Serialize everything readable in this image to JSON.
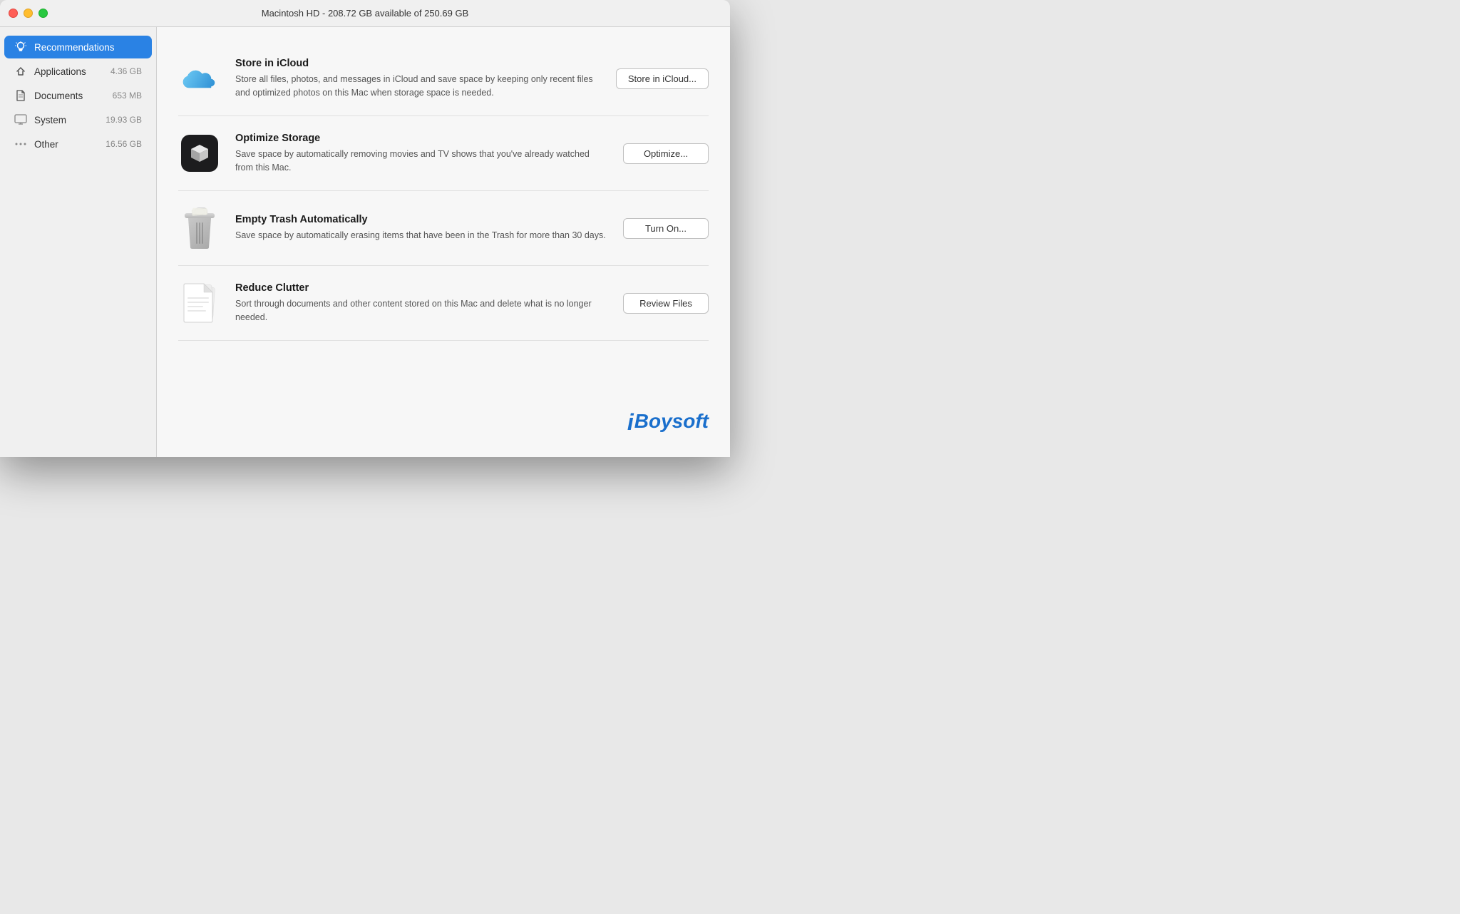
{
  "titlebar": {
    "title": "Macintosh HD - 208.72 GB available of 250.69 GB"
  },
  "sidebar": {
    "items": [
      {
        "id": "recommendations",
        "label": "Recommendations",
        "size": "",
        "active": true,
        "icon": "lightbulb"
      },
      {
        "id": "applications",
        "label": "Applications",
        "size": "4.36 GB",
        "active": false,
        "icon": "applications"
      },
      {
        "id": "documents",
        "label": "Documents",
        "size": "653 MB",
        "active": false,
        "icon": "document"
      },
      {
        "id": "system",
        "label": "System",
        "size": "19.93 GB",
        "active": false,
        "icon": "computer"
      },
      {
        "id": "other",
        "label": "Other",
        "size": "16.56 GB",
        "active": false,
        "icon": "dots"
      }
    ]
  },
  "recommendations": [
    {
      "id": "icloud",
      "title": "Store in iCloud",
      "description": "Store all files, photos, and messages in iCloud and save space by keeping only recent files and optimized photos on this Mac when storage space is needed.",
      "button_label": "Store in iCloud...",
      "icon": "icloud"
    },
    {
      "id": "optimize",
      "title": "Optimize Storage",
      "description": "Save space by automatically removing movies and TV shows that you've already watched from this Mac.",
      "button_label": "Optimize...",
      "icon": "appletv"
    },
    {
      "id": "empty-trash",
      "title": "Empty Trash Automatically",
      "description": "Save space by automatically erasing items that have been in the Trash for more than 30 days.",
      "button_label": "Turn On...",
      "icon": "trash"
    },
    {
      "id": "reduce-clutter",
      "title": "Reduce Clutter",
      "description": "Sort through documents and other content stored on this Mac and delete what is no longer needed.",
      "button_label": "Review Files",
      "icon": "document"
    }
  ],
  "watermark": {
    "text": "iBoysoft"
  }
}
